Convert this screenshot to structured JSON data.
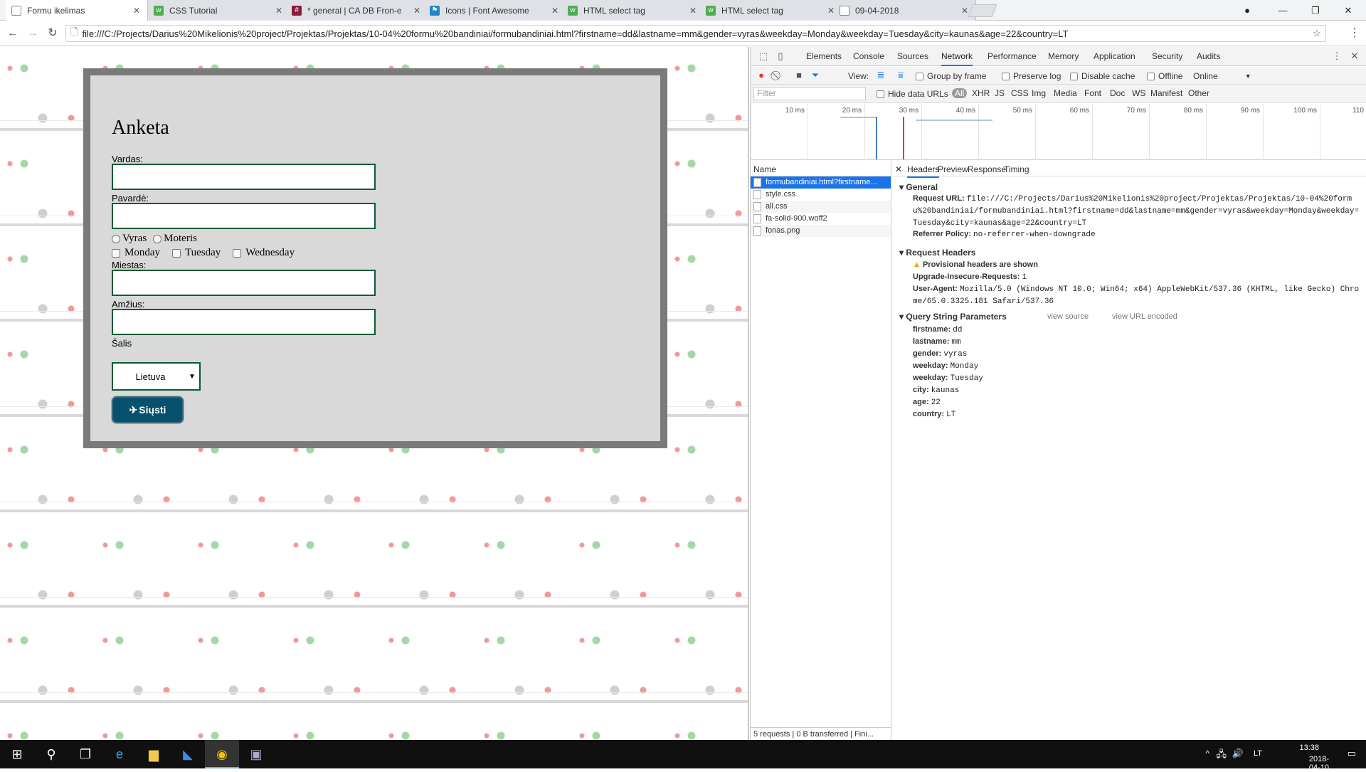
{
  "browser": {
    "tabs": [
      {
        "title": "Formu ikelimas",
        "icon": "page-icon",
        "active": true
      },
      {
        "title": "CSS Tutorial",
        "icon": "w3schools-icon"
      },
      {
        "title": "* general | CA DB Fron-e",
        "icon": "slack-icon"
      },
      {
        "title": "Icons | Font Awesome",
        "icon": "fontawesome-icon"
      },
      {
        "title": "HTML select tag",
        "icon": "w3schools-icon"
      },
      {
        "title": "HTML select tag",
        "icon": "w3schools-icon"
      },
      {
        "title": "09-04-2018",
        "icon": "page-icon"
      }
    ],
    "url": "file:///C:/Projects/Darius%20Mikelionis%20project/Projektas/Projektas/10-04%20formu%20bandiniai/formubandiniai.html?firstname=dd&lastname=mm&gender=vyras&weekday=Monday&weekday=Tuesday&city=kaunas&age=22&country=LT"
  },
  "form": {
    "title": "Anketa",
    "firstname_label": "Vardas:",
    "lastname_label": "Pavardė:",
    "gender_options": [
      "Vyras",
      "Moteris"
    ],
    "weekday_options": [
      "Monday",
      "Tuesday",
      "Wednesday"
    ],
    "city_label": "Miestas:",
    "age_label": "Amžius:",
    "country_label": "Šalis",
    "country_value": "Lietuva",
    "send_label": "Siųsti",
    "send_icon": "paper-plane-icon"
  },
  "devtools": {
    "tabs": [
      "Elements",
      "Console",
      "Sources",
      "Network",
      "Performance",
      "Memory",
      "Application",
      "Security",
      "Audits"
    ],
    "active_tab": "Network",
    "toolbar": {
      "view_label": "View:",
      "group_by_frame": "Group by frame",
      "preserve_log": "Preserve log",
      "disable_cache": "Disable cache",
      "offline": "Offline",
      "online": "Online"
    },
    "filter_placeholder": "Filter",
    "hide_data_urls": "Hide data URLs",
    "filter_types": [
      "All",
      "XHR",
      "JS",
      "CSS",
      "Img",
      "Media",
      "Font",
      "Doc",
      "WS",
      "Manifest",
      "Other"
    ],
    "timeline_ticks": [
      "10 ms",
      "20 ms",
      "30 ms",
      "40 ms",
      "50 ms",
      "60 ms",
      "70 ms",
      "80 ms",
      "90 ms",
      "100 ms",
      "110"
    ],
    "name_header": "Name",
    "requests": [
      "formubandiniai.html?firstname...",
      "style.css",
      "all.css",
      "fa-solid-900.woff2",
      "fonas.png"
    ],
    "status": "5 requests  |  0 B transferred  |  Fini...",
    "detail_tabs": [
      "Headers",
      "Preview",
      "Response",
      "Timing"
    ],
    "general": {
      "title": "General",
      "request_url_label": "Request URL:",
      "request_url_value": "file:///C:/Projects/Darius%20Mikelionis%20project/Projektas/Projektas/10-04%20formu%20bandiniai/formubandiniai.html?firstname=dd&lastname=mm&gender=vyras&weekday=Monday&weekday=Tuesday&city=kaunas&age=22&country=LT",
      "referrer_label": "Referrer Policy:",
      "referrer_value": "no-referrer-when-downgrade"
    },
    "request_headers": {
      "title": "Request Headers",
      "warning": "Provisional headers are shown",
      "upgrade_label": "Upgrade-Insecure-Requests:",
      "upgrade_value": "1",
      "ua_label": "User-Agent:",
      "ua_value": "Mozilla/5.0 (Windows NT 10.0; Win64; x64) AppleWebKit/537.36 (KHTML, like Gecko) Chrome/65.0.3325.181 Safari/537.36"
    },
    "query": {
      "title": "Query String Parameters",
      "view_source": "view source",
      "view_url_encoded": "view URL encoded",
      "params": [
        {
          "k": "firstname:",
          "v": "dd"
        },
        {
          "k": "lastname:",
          "v": "mm"
        },
        {
          "k": "gender:",
          "v": "vyras"
        },
        {
          "k": "weekday:",
          "v": "Monday"
        },
        {
          "k": "weekday:",
          "v": "Tuesday"
        },
        {
          "k": "city:",
          "v": "kaunas"
        },
        {
          "k": "age:",
          "v": "22"
        },
        {
          "k": "country:",
          "v": "LT"
        }
      ]
    }
  },
  "taskbar": {
    "lang": "LT",
    "time": "13:38",
    "date": "2018-04-10"
  }
}
